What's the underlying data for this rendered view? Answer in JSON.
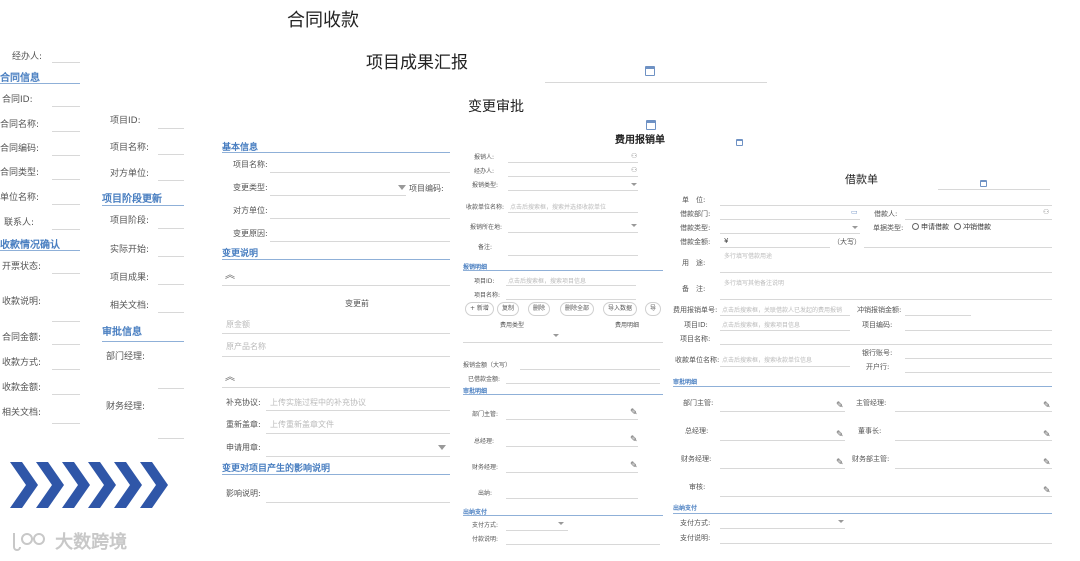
{
  "titles": {
    "contract_receipt": "合同收款",
    "project_report": "项目成果汇报",
    "change_approval": "变更审批",
    "expense_reimbursement": "费用报销单",
    "loan_form": "借款单"
  },
  "contract_form": {
    "handler": "经办人:",
    "section_contract_info": "合同信息",
    "contract_id": "合同ID:",
    "contract_name": "合同名称:",
    "contract_code": "合同编码:",
    "contract_type": "合同类型:",
    "unit_name": "单位名称:",
    "contact": "联系人:",
    "section_receipt_confirm": "收款情况确认",
    "invoice_status": "开票状态:",
    "receipt_desc": "收款说明:",
    "contract_amount": "合同金额:",
    "receipt_method": "收款方式:",
    "receipt_amount": "收款金额:",
    "related_docs": "相关文档:"
  },
  "project_form": {
    "project_id": "项目ID:",
    "project_name": "项目名称:",
    "counterparty": "对方单位:",
    "section_stage_update": "项目阶段更新",
    "project_stage": "项目阶段:",
    "actual_start": "实际开始:",
    "project_result": "项目成果:",
    "related_docs": "相关文档:",
    "section_approval_info": "审批信息",
    "dept_manager": "部门经理:",
    "finance_manager": "财务经理:"
  },
  "change_form": {
    "section_basic": "基本信息",
    "project_name": "项目名称:",
    "change_type": "变更类型:",
    "project_code": "项目编码:",
    "counterparty": "对方单位:",
    "change_reason": "变更原因:",
    "section_change_desc": "变更说明",
    "before_change": "变更前",
    "ph_original_amount": "原金额",
    "ph_original_product": "原产品名称",
    "supplement": "补充协议:",
    "supplement_ph": "上传实施过程中的补充协议",
    "re_stamp": "重新盖章:",
    "re_stamp_ph": "上传重新盖章文件",
    "seal_use": "申请用章:",
    "section_impact": "变更对项目产生的影响说明",
    "impact_desc": "影响说明:"
  },
  "expense_form": {
    "applicant": "报销人:",
    "handler": "经办人:",
    "expense_type": "报销类型:",
    "payee_unit": "收款单位名称:",
    "payee_unit_ph": "点击后搜索框，搜索并选择收款单位",
    "belong_dept": "报销所在地:",
    "remark": "备注:",
    "section_detail": "报销明细",
    "project_id": "项目ID:",
    "project_id_ph": "点击后搜索框，搜索项目信息",
    "project_name": "项目名称:",
    "btn_new": "+ 新增",
    "btn_copy": "复制",
    "btn_delete": "删除",
    "btn_delete_all": "删除全部",
    "btn_import": "导入数据",
    "btn_export": "导",
    "col_expense_type": "费用类型",
    "col_expense_detail": "费用明细",
    "total_amount": "报销金额（大写）",
    "paid_amount": "已借款金额:",
    "section_approval": "审批明细",
    "dept_head": "部门主管:",
    "general_manager": "总经理:",
    "finance_manager": "财务经理:",
    "cashier": "出纳:",
    "section_payment": "出纳支付",
    "pay_method": "支付方式:",
    "pay_desc": "付款说明:"
  },
  "loan_form": {
    "unit": "单　位:",
    "dept": "借款部门:",
    "borrower": "借款人:",
    "loan_type": "借款类型:",
    "form_type": "单据类型:",
    "radio_apply": "申请借款",
    "radio_offset": "冲销借款",
    "amount": "借款金额:",
    "currency": "¥",
    "uppercase": "（大写）",
    "purpose": "用　途:",
    "purpose_ph": "多行填写借款用途",
    "remark": "备　注:",
    "remark_ph": "多行填写其他备注说明",
    "related_form": "费用报销单号:",
    "related_form_ph": "点击后搜索框，关联借款人已发起的费用报销",
    "offset_amount": "冲销报销金额:",
    "project_id": "项目ID:",
    "project_id_ph": "点击后搜索框，搜索项目信息",
    "project_code": "项目编码:",
    "project_name": "项目名称:",
    "payee_unit": "收款单位名称:",
    "payee_unit_ph": "点击后搜索框，搜索收款单位信息",
    "bank_account": "银行账号:",
    "bank": "开户行:",
    "section_approval": "审批明细",
    "dept_head": "部门主管:",
    "supervisor": "主管经理:",
    "general_manager": "总经理:",
    "chairman": "董事长:",
    "finance_manager": "财务经理:",
    "finance_head": "财务部主管:",
    "review": "审核:",
    "section_payment": "出纳支付",
    "pay_method": "支付方式:",
    "pay_desc": "支付说明:"
  },
  "brand": {
    "name": "大数跨境"
  },
  "colors": {
    "accent": "#4a7fc1",
    "chevron": "#2f56a8"
  }
}
